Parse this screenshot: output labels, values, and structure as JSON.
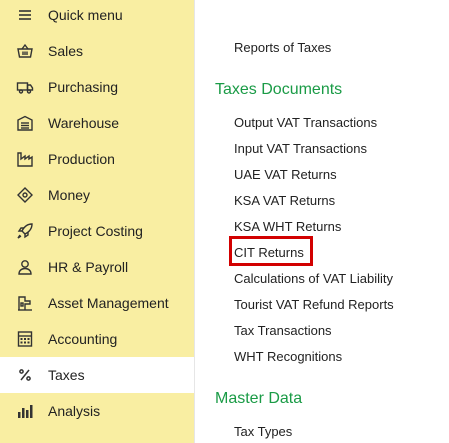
{
  "sidebar": {
    "items": [
      {
        "label": "Quick menu",
        "icon": "menu-icon"
      },
      {
        "label": "Sales",
        "icon": "basket-icon"
      },
      {
        "label": "Purchasing",
        "icon": "truck-icon"
      },
      {
        "label": "Warehouse",
        "icon": "warehouse-icon"
      },
      {
        "label": "Production",
        "icon": "factory-icon"
      },
      {
        "label": "Money",
        "icon": "money-icon"
      },
      {
        "label": "Project Costing",
        "icon": "rocket-icon"
      },
      {
        "label": "HR & Payroll",
        "icon": "person-icon"
      },
      {
        "label": "Asset Management",
        "icon": "asset-icon"
      },
      {
        "label": "Accounting",
        "icon": "calculator-icon"
      },
      {
        "label": "Taxes",
        "icon": "percent-icon"
      },
      {
        "label": "Analysis",
        "icon": "chart-icon"
      }
    ],
    "active": "Taxes"
  },
  "content": {
    "reports_link": "Reports of Taxes",
    "sections": [
      {
        "title": "Taxes Documents",
        "links": [
          "Output VAT Transactions",
          "Input VAT Transactions",
          "UAE VAT Returns",
          "KSA VAT Returns",
          "KSA WHT Returns",
          "CIT Returns",
          "Calculations of VAT Liability",
          "Tourist VAT Refund Reports",
          "Tax Transactions",
          "WHT Recognitions"
        ]
      },
      {
        "title": "Master Data",
        "links": [
          "Tax Types"
        ]
      }
    ],
    "highlighted_link": "CIT Returns"
  },
  "colors": {
    "sidebar_bg": "#f9eea2",
    "section_title": "#1a9b46",
    "highlight_border": "#d20000"
  }
}
